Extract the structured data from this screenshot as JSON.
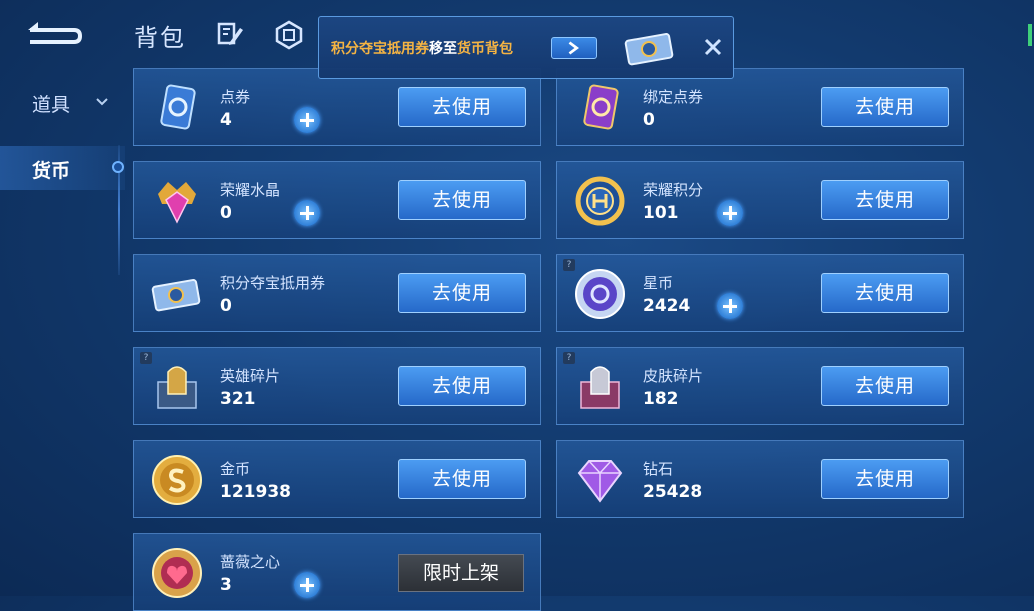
{
  "header": {
    "title": "背包",
    "icons": [
      "back-arrow-icon",
      "edit-icon",
      "settings-tab-icon"
    ]
  },
  "sidebar": {
    "items": [
      {
        "label": "道具",
        "icon": "chevron-down-icon"
      },
      {
        "label": "货币",
        "active": true
      }
    ]
  },
  "toast": {
    "part1": "积分夺宝抵用券",
    "part2": "移至",
    "part3": "货币背包",
    "highlight_color": "#f5b443",
    "icons": [
      "arrow-right-icon",
      "ticket-icon",
      "close-icon"
    ]
  },
  "cards": [
    {
      "name": "点券",
      "count": "4",
      "button": "去使用",
      "icon": "voucher-icon"
    },
    {
      "name": "绑定点券",
      "count": "0",
      "button": "去使用",
      "icon": "bound-voucher-icon"
    },
    {
      "name": "荣耀水晶",
      "count": "0",
      "button": "去使用",
      "icon": "glory-crystal-icon"
    },
    {
      "name": "荣耀积分",
      "count": "101",
      "button": "去使用",
      "icon": "glory-points-icon"
    },
    {
      "name": "积分夺宝抵用券",
      "count": "0",
      "button": "去使用",
      "icon": "treasure-coupon-icon"
    },
    {
      "name": "星币",
      "count": "2424",
      "button": "去使用",
      "icon": "star-coin-icon"
    },
    {
      "name": "英雄碎片",
      "count": "321",
      "button": "去使用",
      "icon": "hero-fragment-icon"
    },
    {
      "name": "皮肤碎片",
      "count": "182",
      "button": "去使用",
      "icon": "skin-fragment-icon"
    },
    {
      "name": "金币",
      "count": "121938",
      "button": "去使用",
      "icon": "gold-coin-icon"
    },
    {
      "name": "钻石",
      "count": "25428",
      "button": "去使用",
      "icon": "diamond-icon"
    },
    {
      "name": "蔷薇之心",
      "count": "3",
      "tag": "限时上架",
      "icon": "rose-heart-icon"
    }
  ],
  "colors": {
    "background": "#123a6e",
    "button": "#2f7fd8",
    "accent_gold": "#f5b443"
  }
}
